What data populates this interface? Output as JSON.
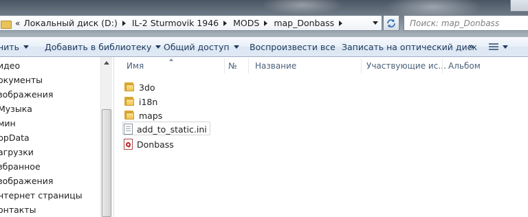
{
  "address_bar": {
    "overflow_chevron": "«",
    "crumbs": [
      "Локальный диск (D:)",
      "IL-2 Sturmovik 1946",
      "MODS",
      "map_Donbass"
    ]
  },
  "search": {
    "placeholder": "Поиск: map_Donbass"
  },
  "toolbar": {
    "organize_label": "нить",
    "add_to_library_label": "Добавить в библиотеку",
    "share_label": "Общий доступ",
    "play_all_label": "Воспроизвести все",
    "burn_label": "Записать на оптический диск",
    "more_label": "»"
  },
  "nav_pane": {
    "items": [
      "идео",
      "окументы",
      "зображения",
      "Музыка",
      "мин",
      "ppData",
      "агрузки",
      "збранное",
      "зображения",
      "нтернет страницы",
      "онтакты"
    ]
  },
  "columns": {
    "name": "Имя",
    "number": "№",
    "title": "Название",
    "artists": "Участвующие ис...",
    "album": "Альбом"
  },
  "files": [
    {
      "name": "3do",
      "icon": "folder-icon"
    },
    {
      "name": "i18n",
      "icon": "folder-icon"
    },
    {
      "name": "maps",
      "icon": "folder-icon"
    },
    {
      "name": "add_to_static.ini",
      "icon": "text-file-icon"
    },
    {
      "name": "Donbass",
      "icon": "pdf-icon"
    }
  ],
  "colors": {
    "toolbar_text": "#1e395b",
    "header_text": "#4c607a",
    "folder": "#f0c552"
  }
}
